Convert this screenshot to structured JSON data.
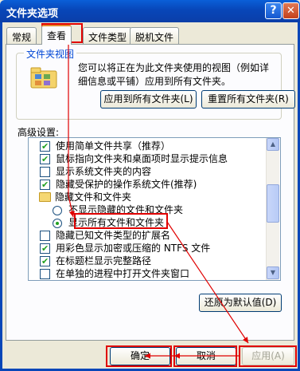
{
  "window": {
    "title": "文件夹选项",
    "help_glyph": "?",
    "close_glyph": "✕"
  },
  "tabs": [
    {
      "label": "常规",
      "active": false
    },
    {
      "label": "查看",
      "active": true
    },
    {
      "label": "文件类型",
      "active": false
    },
    {
      "label": "脱机文件",
      "active": false
    }
  ],
  "folder_view": {
    "title": "文件夹视图",
    "description": "您可以将正在为此文件夹使用的视图（例如详细信息或平铺）应用到所有文件夹。",
    "apply_all_button": "应用到所有文件夹(L)",
    "reset_all_button": "重置所有文件夹(R)"
  },
  "advanced": {
    "label": "高级设置:",
    "items": [
      {
        "type": "checkbox",
        "checked": true,
        "label": "使用简单文件共享（推荐）"
      },
      {
        "type": "checkbox",
        "checked": true,
        "label": "鼠标指向文件夹和桌面项时显示提示信息"
      },
      {
        "type": "checkbox",
        "checked": false,
        "label": "显示系统文件夹的内容"
      },
      {
        "type": "checkbox",
        "checked": true,
        "label": "隐藏受保护的操作系统文件(推荐)"
      },
      {
        "type": "folder",
        "label": "隐藏文件和文件夹"
      },
      {
        "type": "radio",
        "checked": false,
        "label": "不显示隐藏的文件和文件夹"
      },
      {
        "type": "radio",
        "checked": true,
        "label": "显示所有文件和文件夹"
      },
      {
        "type": "checkbox",
        "checked": false,
        "label": "隐藏已知文件类型的扩展名"
      },
      {
        "type": "checkbox",
        "checked": true,
        "label": "用彩色显示加密或压缩的 NTFS 文件"
      },
      {
        "type": "checkbox",
        "checked": true,
        "label": "在标题栏显示完整路径"
      },
      {
        "type": "checkbox",
        "checked": false,
        "label": "在单独的进程中打开文件夹窗口"
      }
    ],
    "restore_defaults_button": "还原为默认值(D)"
  },
  "footer": {
    "ok_button": "确定",
    "cancel_button": "取消",
    "apply_button": "应用(A)"
  },
  "annotation_color": "#e00000"
}
